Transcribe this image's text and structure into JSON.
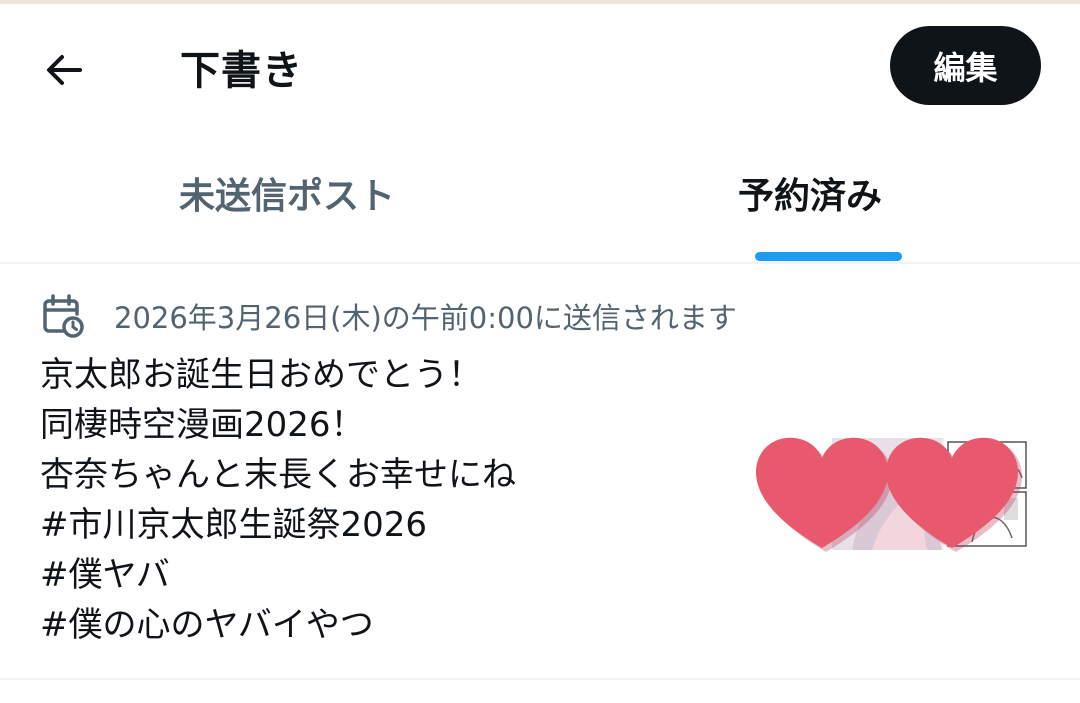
{
  "header": {
    "title": "下書き",
    "edit_label": "編集",
    "back_icon": "arrow-left-icon"
  },
  "tabs": [
    {
      "label": "未送信ポスト",
      "selected": false
    },
    {
      "label": "予約済み",
      "selected": true
    }
  ],
  "colors": {
    "accent": "#1d9bf0",
    "text_primary": "#0f1419",
    "text_secondary": "#536471",
    "heart": "#e8596e"
  },
  "draft": {
    "schedule_icon": "calendar-clock-icon",
    "schedule_text": "2026年3月26日(木)の午前0:00に送信されます",
    "lines": [
      "京太郎お誕生日おめでとう！",
      "同棲時空漫画2026！",
      "杏奈ちゃんと末長くお幸せにね",
      "#市川京太郎生誕祭2026",
      "#僕ヤバ",
      "#僕の心のヤバイやつ"
    ],
    "thumbnail_icon": "heart-icon"
  }
}
